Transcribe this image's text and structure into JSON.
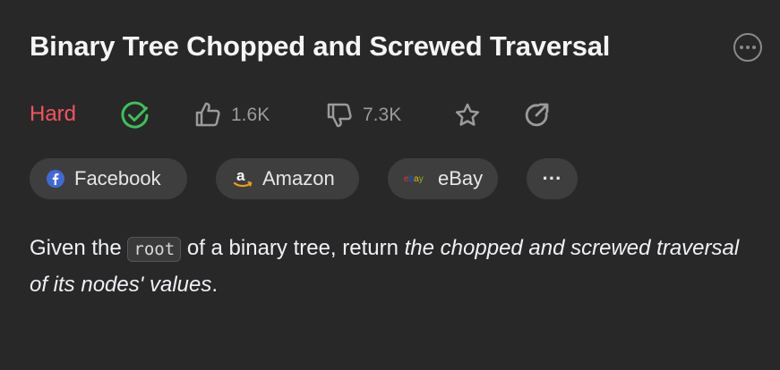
{
  "problem": {
    "title": "Binary Tree Chopped and Screwed Traversal",
    "difficulty": "Hard",
    "likes": "1.6K",
    "dislikes": "7.3K"
  },
  "tags": [
    {
      "label": "Facebook"
    },
    {
      "label": "Amazon"
    },
    {
      "label": "eBay"
    }
  ],
  "tags_more_label": "···",
  "description": {
    "part1": "Given the ",
    "code": "root",
    "part2": " of a binary tree, return ",
    "emphasis": "the chopped and screwed traversal of its nodes' values",
    "part3": "."
  },
  "colors": {
    "background": "#282828",
    "difficulty_hard": "#f4535f",
    "solved_check": "#3fbf5a",
    "muted_icon": "#9b9b9b"
  },
  "icons": [
    "more-options-icon",
    "solved-check-icon",
    "thumbs-up-icon",
    "thumbs-down-icon",
    "star-icon",
    "share-icon",
    "facebook-icon",
    "amazon-icon",
    "ebay-icon"
  ]
}
